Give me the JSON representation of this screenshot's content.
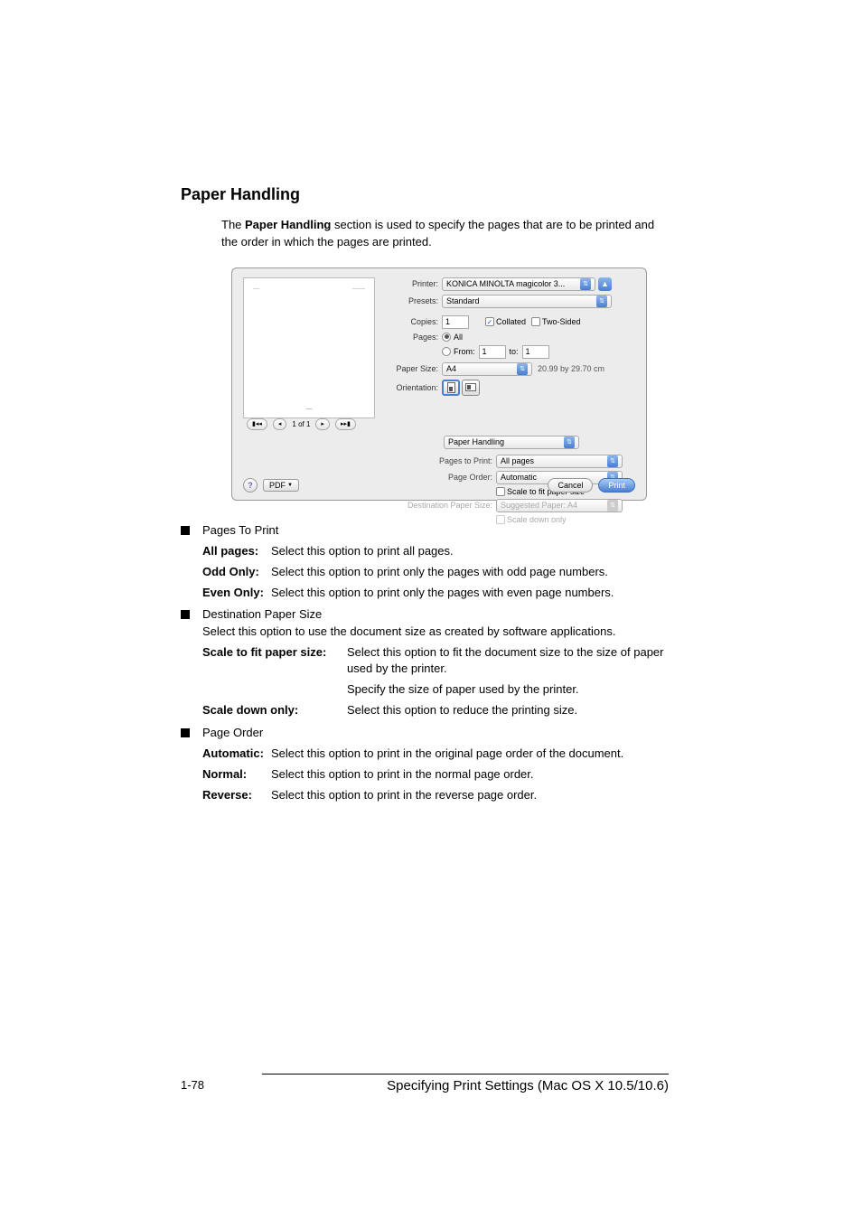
{
  "section": {
    "title": "Paper Handling",
    "intro_pre": "The ",
    "intro_bold": "Paper Handling",
    "intro_post": " section is used to specify the pages that are to be printed and the order in which the pages are printed."
  },
  "dialog": {
    "printer_label": "Printer:",
    "printer_value": "KONICA MINOLTA magicolor 3...",
    "presets_label": "Presets:",
    "presets_value": "Standard",
    "copies_label": "Copies:",
    "copies_value": "1",
    "collated_label": "Collated",
    "two_sided_label": "Two-Sided",
    "pages_label": "Pages:",
    "pages_all": "All",
    "pages_from": "From:",
    "pages_from_val": "1",
    "pages_to": "to:",
    "pages_to_val": "1",
    "papersize_label": "Paper Size:",
    "papersize_value": "A4",
    "papersize_dim": "20.99 by 29.70 cm",
    "orientation_label": "Orientation:",
    "panel_select": "Paper Handling",
    "pages_to_print_label": "Pages to Print:",
    "pages_to_print_value": "All pages",
    "page_order_label": "Page Order:",
    "page_order_value": "Automatic",
    "scale_fit_label": "Scale to fit paper size",
    "dest_size_label": "Destination Paper Size:",
    "dest_size_value": "Suggested Paper: A4",
    "scale_down_label": "Scale down only",
    "pager_text": "1 of 1",
    "pdf_label": "PDF",
    "cancel": "Cancel",
    "print": "Print",
    "status_icon": "▲"
  },
  "b1": {
    "title": "Pages To Print",
    "r1_term": "All pages",
    "r1_desc": "Select this option to print all pages.",
    "r2_term": "Odd Only",
    "r2_desc": "Select this option to print only the pages with odd page numbers.",
    "r3_term": "Even Only",
    "r3_desc": "Select this option to print only the pages with even page numbers."
  },
  "b2": {
    "title": "Destination Paper Size",
    "intro": "Select this option to use the document size as created by software applications.",
    "r1_term": "Scale to fit paper size",
    "r1_desc": "Select this option to fit the document size to the size of paper used by the printer.",
    "r1_extra": "Specify the size of paper used by the printer.",
    "r2_term": "Scale down only",
    "r2_desc": "Select this option to reduce the printing size."
  },
  "b3": {
    "title": "Page Order",
    "r1_term": "Automatic",
    "r1_desc": "Select this option to print in the original page order of the document.",
    "r2_term": "Normal",
    "r2_desc": "Select this option to print in the normal page order.",
    "r3_term": "Reverse",
    "r3_desc": "Select this option to print in the reverse page order."
  },
  "footer": {
    "page": "1-78",
    "title": "Specifying Print Settings (Mac OS X 10.5/10.6)"
  }
}
